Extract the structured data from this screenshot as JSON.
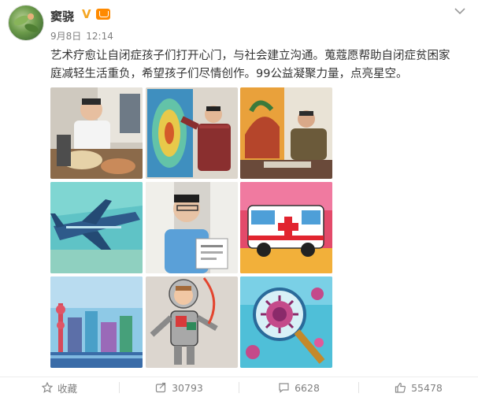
{
  "user": {
    "name": "窦骁",
    "verified_mark": "V"
  },
  "post": {
    "date": "9月8日",
    "time": "12:14",
    "text": "艺术疗愈让自闭症孩子们打开心门，与社会建立沟通。蒐蔻愿帮助自闭症贫困家庭减轻生活重负，希望孩子们尽情创作。99公益凝聚力量，点亮星空。"
  },
  "images": [
    {
      "name": "photo-man-with-paintings"
    },
    {
      "name": "photo-man-painting-canvas"
    },
    {
      "name": "photo-man-painting-table"
    },
    {
      "name": "painting-airplane"
    },
    {
      "name": "photo-boy-with-certificate"
    },
    {
      "name": "painting-ambulance"
    },
    {
      "name": "painting-city-skyline"
    },
    {
      "name": "painting-astronaut"
    },
    {
      "name": "painting-virus-magnifier"
    }
  ],
  "footer": {
    "favorite_label": "收藏",
    "repost_count": "30793",
    "comment_count": "6628",
    "like_count": "55478"
  },
  "colors": {
    "accent": "#ff8a00",
    "verified": "#f5a623",
    "text": "#333333",
    "muted": "#808080"
  }
}
